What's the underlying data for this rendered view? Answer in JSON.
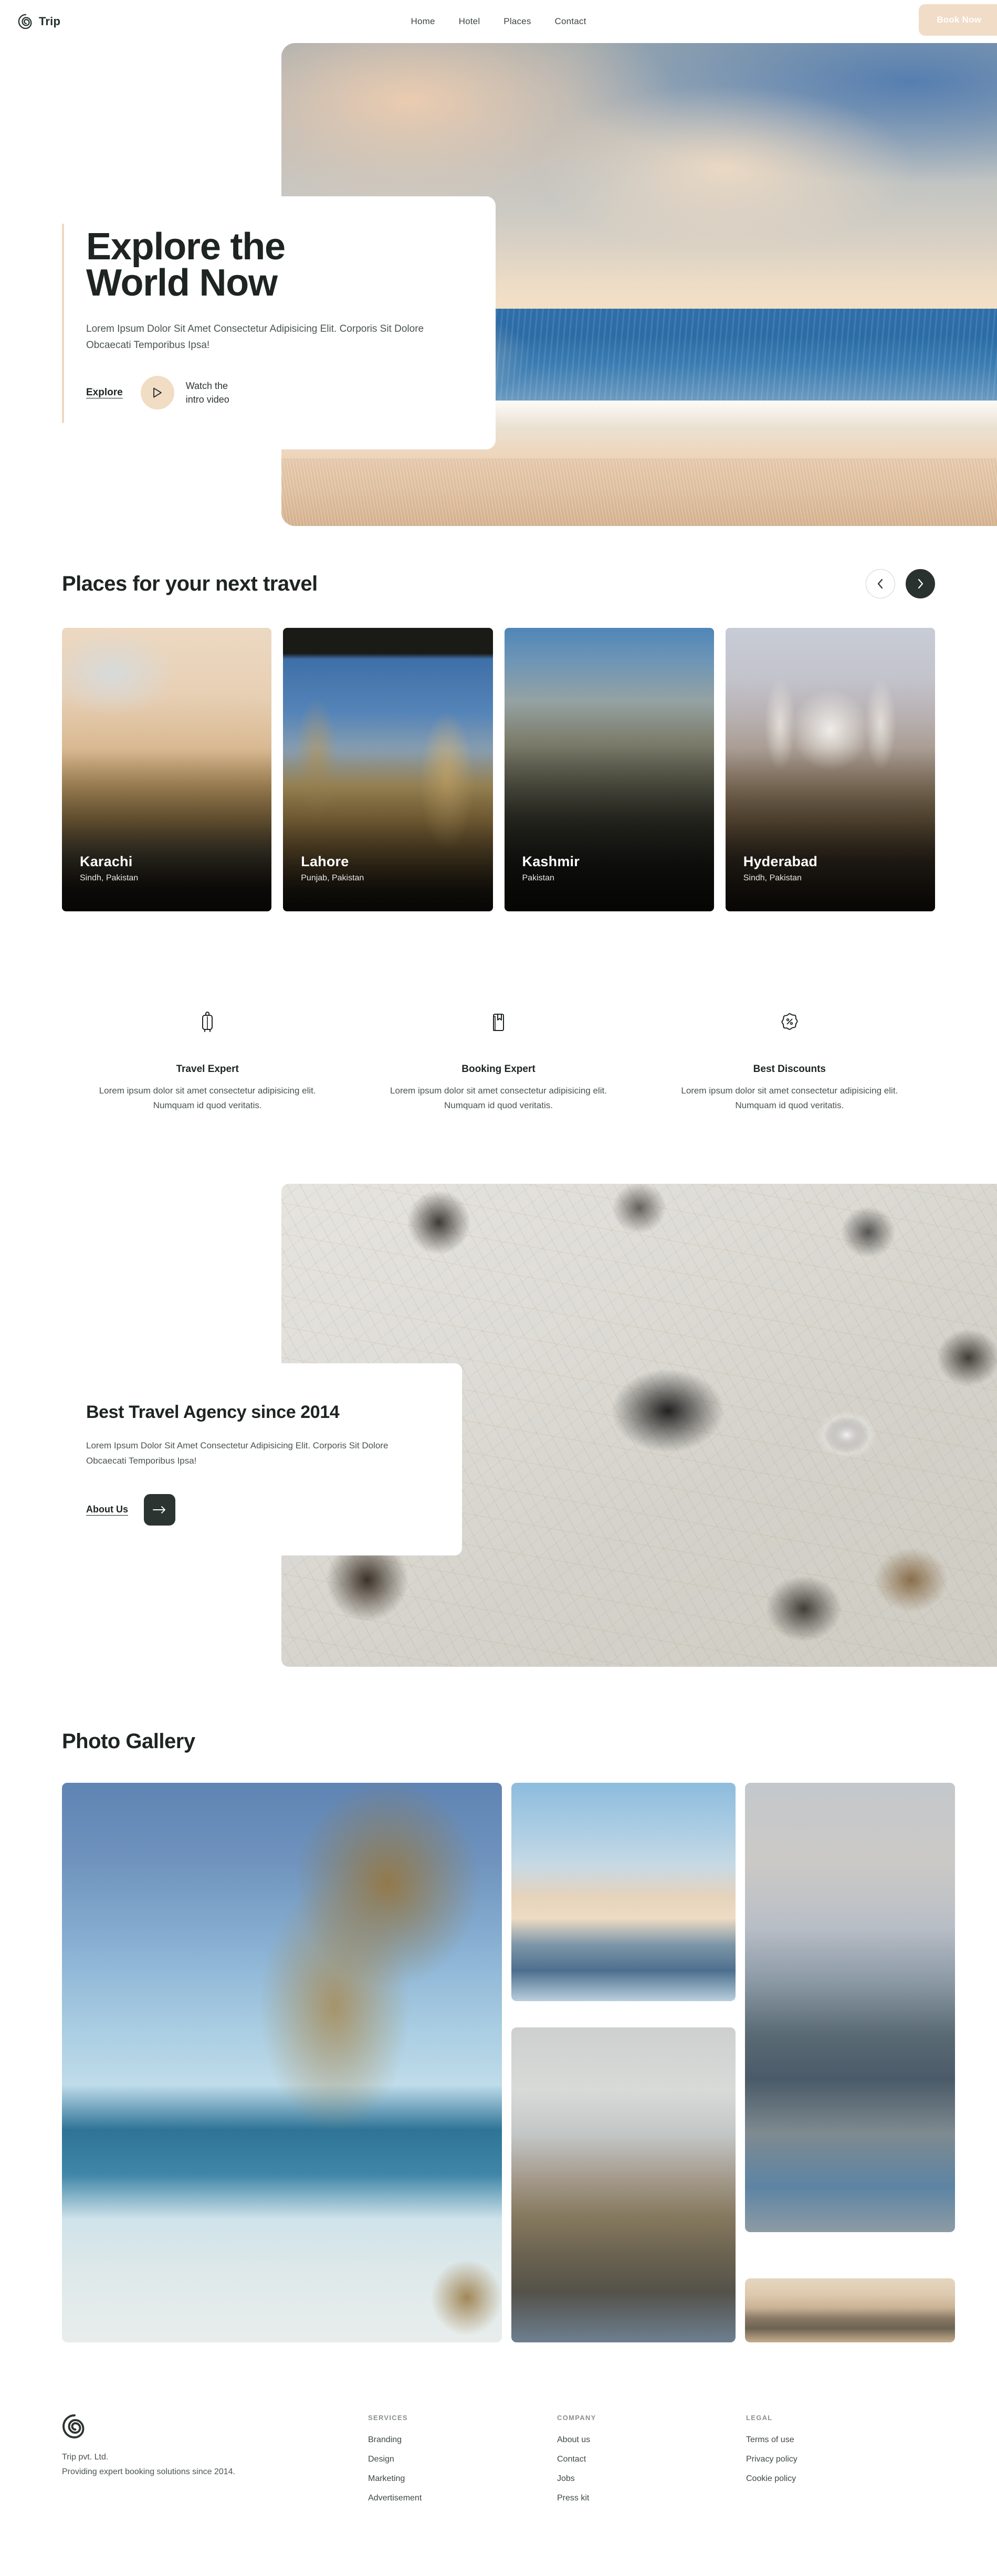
{
  "header": {
    "brand": "Trip",
    "logo_icon": "spiral-logo-icon",
    "nav": [
      {
        "label": "Home"
      },
      {
        "label": "Hotel"
      },
      {
        "label": "Places"
      },
      {
        "label": "Contact"
      }
    ],
    "book_button": "Book Now",
    "book_button_color": "#f0dcc7"
  },
  "hero": {
    "title": "Explore the\nWorld Now",
    "subtitle": "Lorem Ipsum Dolor Sit Amet Consectetur Adipisicing Elit. Corporis Sit Dolore Obcaecati Temporibus Ipsa!",
    "explore_label": "Explore",
    "play_icon": "play-triangle-icon",
    "watch_label": "Watch the\nintro video",
    "accent_color": "#efd8c0"
  },
  "places": {
    "title": "Places for your next travel",
    "prev_icon": "chevron-left-icon",
    "next_icon": "chevron-right-icon",
    "cards": [
      {
        "name": "Karachi",
        "location": "Sindh, Pakistan"
      },
      {
        "name": "Lahore",
        "location": "Punjab, Pakistan"
      },
      {
        "name": "Kashmir",
        "location": "Pakistan"
      },
      {
        "name": "Hyderabad",
        "location": "Sindh, Pakistan"
      }
    ]
  },
  "features": [
    {
      "icon": "suitcase-icon",
      "title": "Travel Expert",
      "text": "Lorem ipsum dolor sit amet consectetur adipisicing elit. Numquam id quod veritatis."
    },
    {
      "icon": "bookmark-book-icon",
      "title": "Booking Expert",
      "text": "Lorem ipsum dolor sit amet consectetur adipisicing elit. Numquam id quod veritatis."
    },
    {
      "icon": "discount-percent-badge-icon",
      "title": "Best Discounts",
      "text": "Lorem ipsum dolor sit amet consectetur adipisicing elit. Numquam id quod veritatis."
    }
  ],
  "agency": {
    "title": "Best Travel Agency since 2014",
    "subtitle": "Lorem Ipsum Dolor Sit Amet Consectetur Adipisicing Elit. Corporis Sit Dolore Obcaecati Temporibus Ipsa!",
    "about_label": "About Us",
    "arrow_icon": "arrow-right-icon"
  },
  "gallery": {
    "title": "Photo Gallery",
    "photos": [
      {
        "caption": "palm-beach-photo"
      },
      {
        "caption": "sunset-shore-photo"
      },
      {
        "caption": "mosque-reflection-tall-photo"
      },
      {
        "caption": "mountain-houseboat-photo"
      },
      {
        "caption": "grand-mosque-wide-photo"
      }
    ]
  },
  "footer": {
    "logo_icon": "spiral-logo-icon",
    "company": "Trip pvt. Ltd.",
    "tagline": "Providing expert booking solutions since 2014.",
    "columns": [
      {
        "heading": "SERVICES",
        "links": [
          {
            "label": "Branding"
          },
          {
            "label": "Design"
          },
          {
            "label": "Marketing"
          },
          {
            "label": "Advertisement"
          }
        ]
      },
      {
        "heading": "COMPANY",
        "links": [
          {
            "label": "About us"
          },
          {
            "label": "Contact"
          },
          {
            "label": "Jobs"
          },
          {
            "label": "Press kit"
          }
        ]
      },
      {
        "heading": "LEGAL",
        "links": [
          {
            "label": "Terms of use"
          },
          {
            "label": "Privacy policy"
          },
          {
            "label": "Cookie policy"
          }
        ]
      }
    ]
  }
}
